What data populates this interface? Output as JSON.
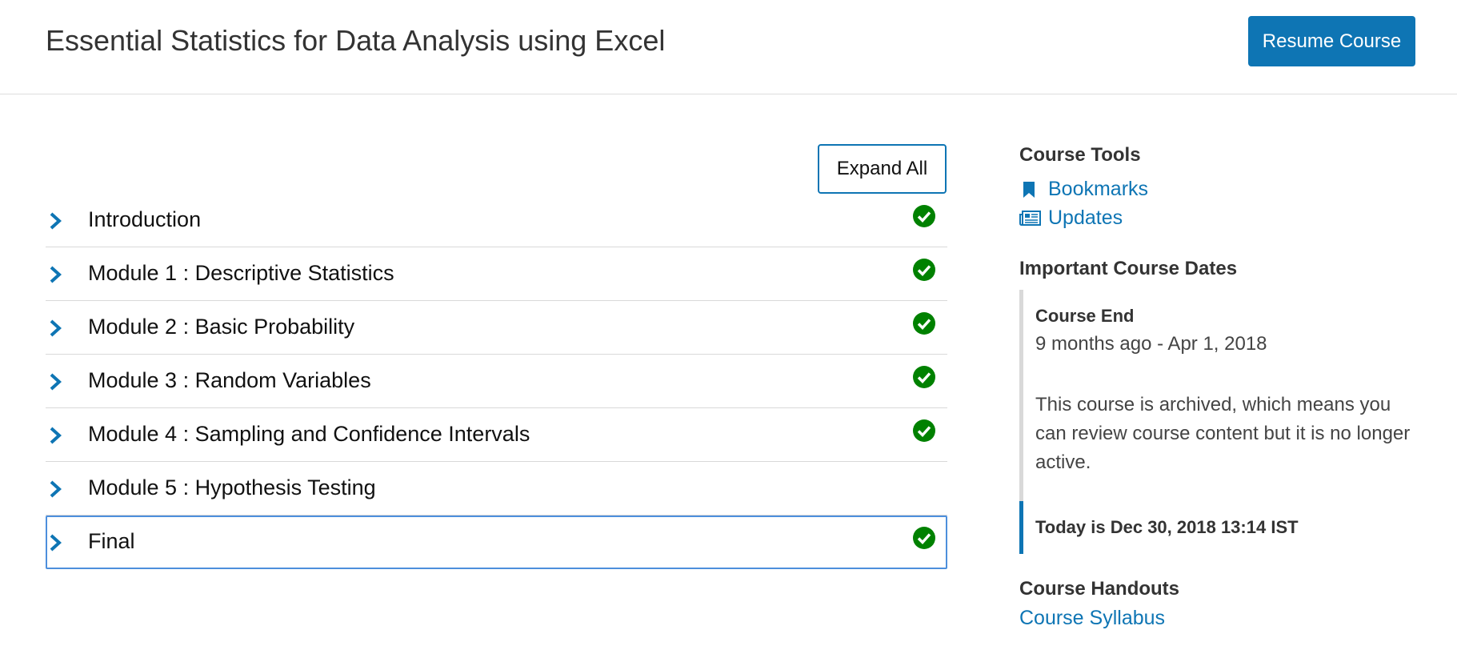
{
  "header": {
    "title": "Essential Statistics for Data Analysis using Excel",
    "resume_label": "Resume Course"
  },
  "outline": {
    "expand_label": "Expand All",
    "sections": [
      {
        "label": "Introduction",
        "completed": true
      },
      {
        "label": "Module 1 : Descriptive Statistics",
        "completed": true
      },
      {
        "label": "Module 2 : Basic Probability",
        "completed": true
      },
      {
        "label": "Module 3 : Random Variables",
        "completed": true
      },
      {
        "label": "Module 4 : Sampling and Confidence Intervals",
        "completed": true
      },
      {
        "label": "Module 5 : Hypothesis Testing",
        "completed": false
      },
      {
        "label": "Final",
        "completed": true
      }
    ]
  },
  "sidebar": {
    "tools_heading": "Course Tools",
    "tools": [
      {
        "label": "Bookmarks",
        "icon": "bookmark-icon"
      },
      {
        "label": "Updates",
        "icon": "newspaper-icon"
      }
    ],
    "dates_heading": "Important Course Dates",
    "dates": {
      "end_label": "Course End",
      "end_value": "9 months ago - Apr 1, 2018",
      "archived_note": "This course is archived, which means you can review course content but it is no longer active.",
      "today": "Today is Dec 30, 2018 13:14 IST"
    },
    "handouts_heading": "Course Handouts",
    "syllabus_label": "Course Syllabus"
  },
  "colors": {
    "accent": "#0e75b4",
    "complete": "#008100",
    "focus_outline": "#4d8fdc"
  }
}
